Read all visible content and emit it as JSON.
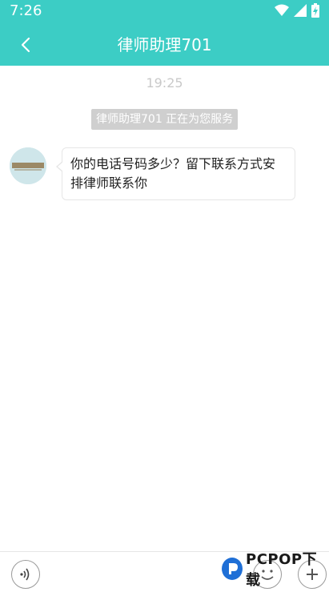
{
  "status_bar": {
    "time": "7:26"
  },
  "header": {
    "title": "律师助理701",
    "back_icon": "chevron-left-icon",
    "color": "#3ccdc5"
  },
  "chat": {
    "timestamp": "19:25",
    "system_notice": "律师助理701 正在为您服务",
    "messages": [
      {
        "sender": "律师助理701",
        "text": "你的电话号码多少？留下联系方式安排律师联系你"
      }
    ]
  },
  "bottom_bar": {
    "voice_icon": "voice-icon",
    "emoji_icon": "emoji-icon",
    "plus_icon": "plus-icon"
  },
  "watermark": {
    "text": "PCPOP下载"
  }
}
